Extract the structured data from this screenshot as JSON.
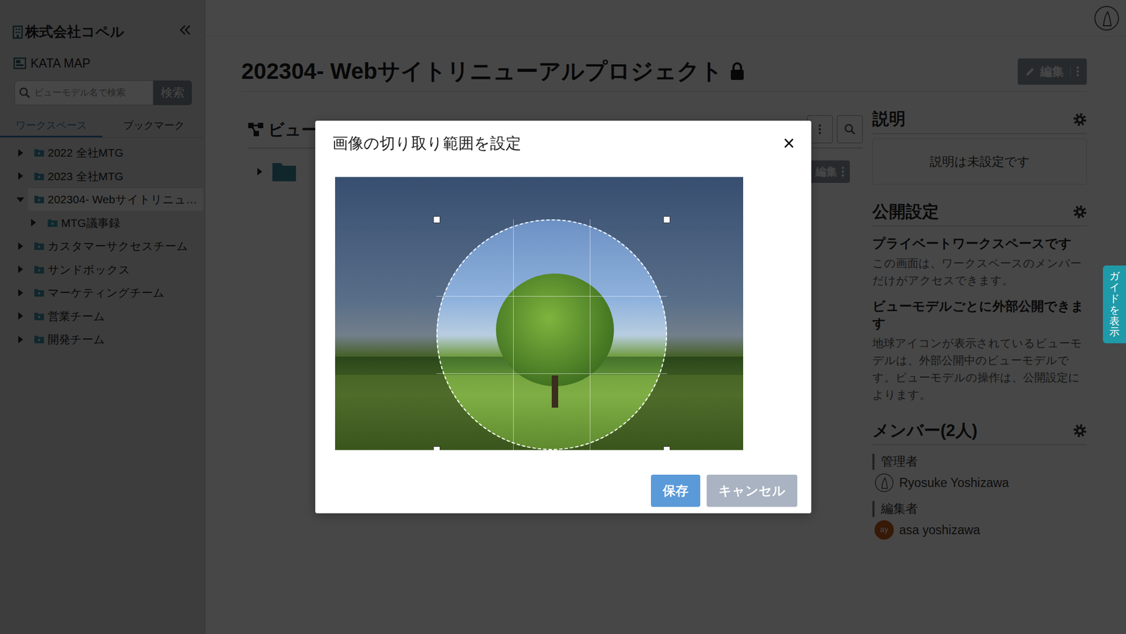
{
  "sidebar": {
    "company": "株式会社コペル",
    "app_link": "KATA MAP",
    "search": {
      "placeholder": "ビューモデル名で検索",
      "button": "検索"
    },
    "tabs": [
      {
        "label": "ワークスペース",
        "selected": true
      },
      {
        "label": "ブックマーク",
        "selected": false
      }
    ],
    "tree": [
      {
        "label": "2022 全社MTG",
        "expanded": false,
        "selected": false,
        "children": []
      },
      {
        "label": "2023 全社MTG",
        "expanded": false,
        "selected": false,
        "children": []
      },
      {
        "label": "202304- Webサイトリニュ…",
        "expanded": true,
        "selected": true,
        "children": [
          {
            "label": "MTG議事録",
            "expanded": false,
            "selected": false,
            "children": []
          }
        ]
      },
      {
        "label": "カスタマーサクセスチーム",
        "expanded": false,
        "selected": false,
        "children": []
      },
      {
        "label": "サンドボックス",
        "expanded": false,
        "selected": false,
        "children": []
      },
      {
        "label": "マーケティングチーム",
        "expanded": false,
        "selected": false,
        "children": []
      },
      {
        "label": "営業チーム",
        "expanded": false,
        "selected": false,
        "children": []
      },
      {
        "label": "開発チーム",
        "expanded": false,
        "selected": false,
        "children": []
      }
    ]
  },
  "page": {
    "title": "202304- Webサイトリニューアルプロジェクト",
    "locked": true,
    "edit_button": "編集"
  },
  "views": {
    "title": "ビュー",
    "folders": [
      {
        "expanded": false,
        "edit_button": "編集"
      }
    ]
  },
  "description": {
    "title": "説明",
    "text": "説明は未設定です"
  },
  "visibility": {
    "title": "公開設定",
    "blocks": [
      {
        "heading": "プライベートワークスペースです",
        "text": "この画面は、ワークスペースのメンバーだけがアクセスできます。"
      },
      {
        "heading": "ビューモデルごとに外部公開できます",
        "text": "地球アイコンが表示されているビューモデルは、外部公開中のビューモデルです。ビューモデルの操作は、公開設定によります。"
      }
    ]
  },
  "members": {
    "title": "メンバー(2人)",
    "groups": [
      {
        "role": "管理者",
        "people": [
          {
            "name": "Ryosuke Yoshizawa",
            "kind": "photo"
          }
        ]
      },
      {
        "role": "編集者",
        "people": [
          {
            "name": "asa yoshizawa",
            "kind": "initials",
            "initials": "ay"
          }
        ]
      }
    ]
  },
  "guide": {
    "label": "ガイドを表示"
  },
  "crop_dialog": {
    "title": "画像の切り取り範囲を設定",
    "close": "×",
    "buttons": [
      {
        "label": "保存",
        "kind": "primary"
      },
      {
        "label": "キャンセル",
        "kind": "secondary"
      }
    ]
  }
}
